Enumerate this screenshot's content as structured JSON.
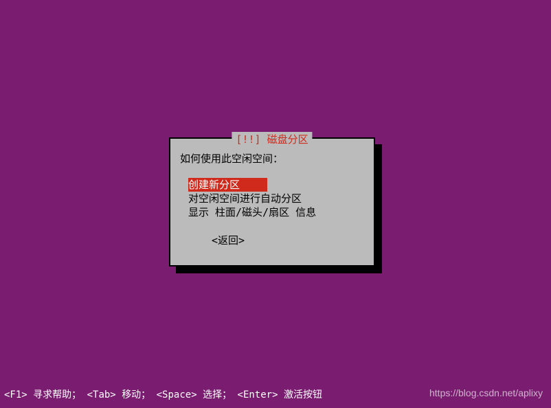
{
  "dialog": {
    "title_prefix": "[!!]",
    "title_text": "磁盘分区",
    "prompt": "如何使用此空闲空间：",
    "menu_items": [
      {
        "label": "创建新分区",
        "selected": true
      },
      {
        "label": "对空闲空间进行自动分区",
        "selected": false
      },
      {
        "label": "显示 柱面/磁头/扇区 信息",
        "selected": false
      }
    ],
    "back_label": "<返回>"
  },
  "footer": {
    "f1_key": "<F1>",
    "f1_text": "寻求帮助；",
    "tab_key": "<Tab>",
    "tab_text": "移动；",
    "space_key": "<Space>",
    "space_text": "选择；",
    "enter_key": "<Enter>",
    "enter_text": "激活按钮"
  },
  "watermark": "https://blog.csdn.net/aplixy"
}
